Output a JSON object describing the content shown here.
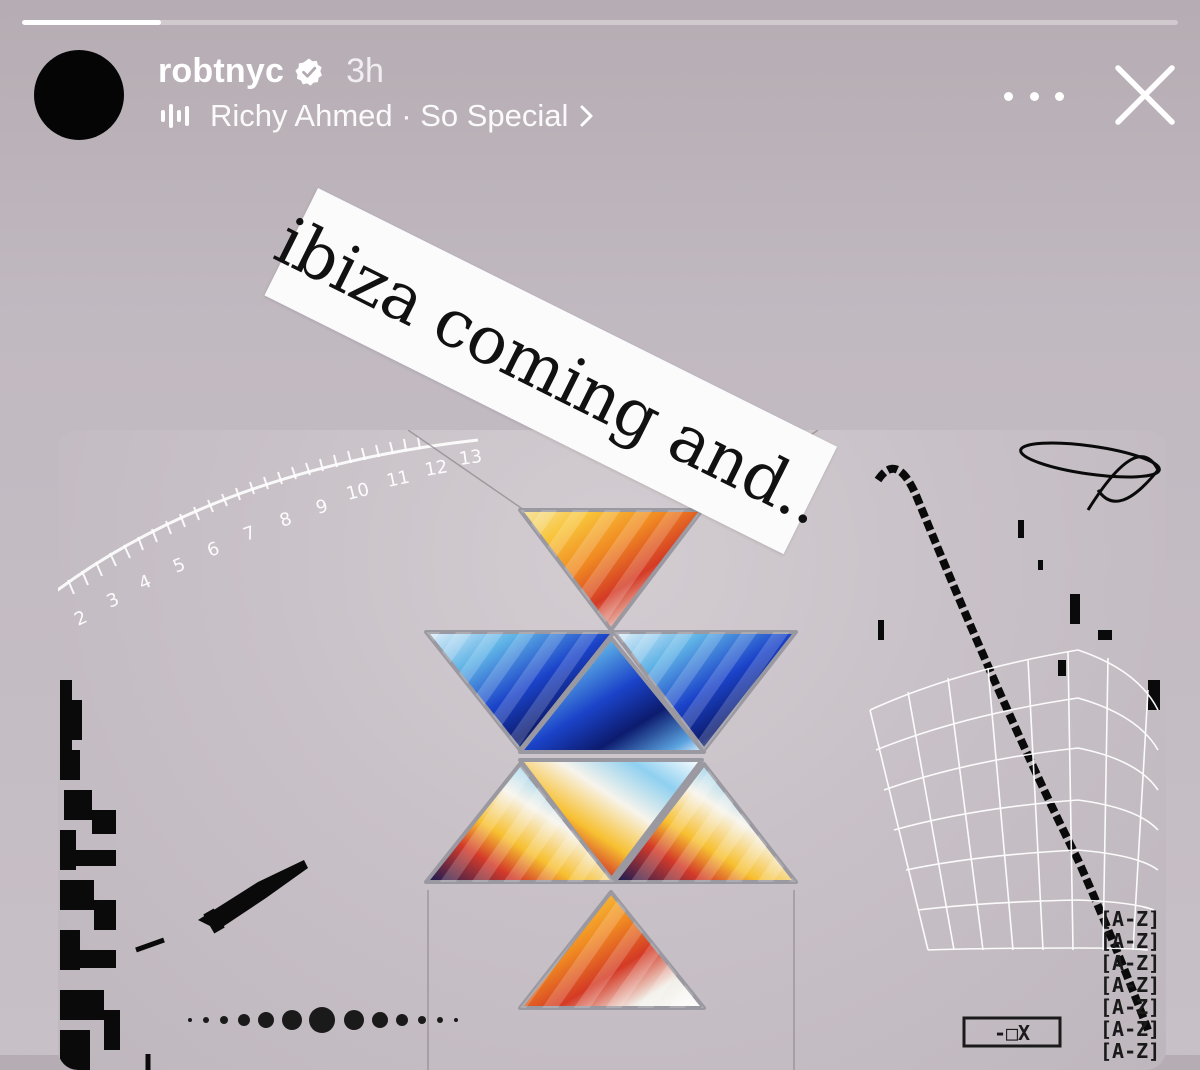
{
  "story": {
    "progress": 0.12,
    "user": {
      "username": "robtnyc",
      "verified": true,
      "time_ago": "3h"
    },
    "music": {
      "track": "Richy Ahmed · So Special",
      "icon": "audio-bars-icon"
    },
    "actions": {
      "more_icon": "more-horizontal-icon",
      "close_icon": "close-icon"
    },
    "caption": "ibiza coming and..",
    "artwork": {
      "ruler_numbers": [
        "2",
        "3",
        "4",
        "5",
        "6",
        "7",
        "8",
        "9",
        "10",
        "11",
        "12",
        "13"
      ],
      "tag_label": "[A-Z]",
      "window_controls": "-□X"
    }
  },
  "colors": {
    "background": "#c1b9c0",
    "text": "#ffffff",
    "sticker": "#fbfbfb"
  }
}
